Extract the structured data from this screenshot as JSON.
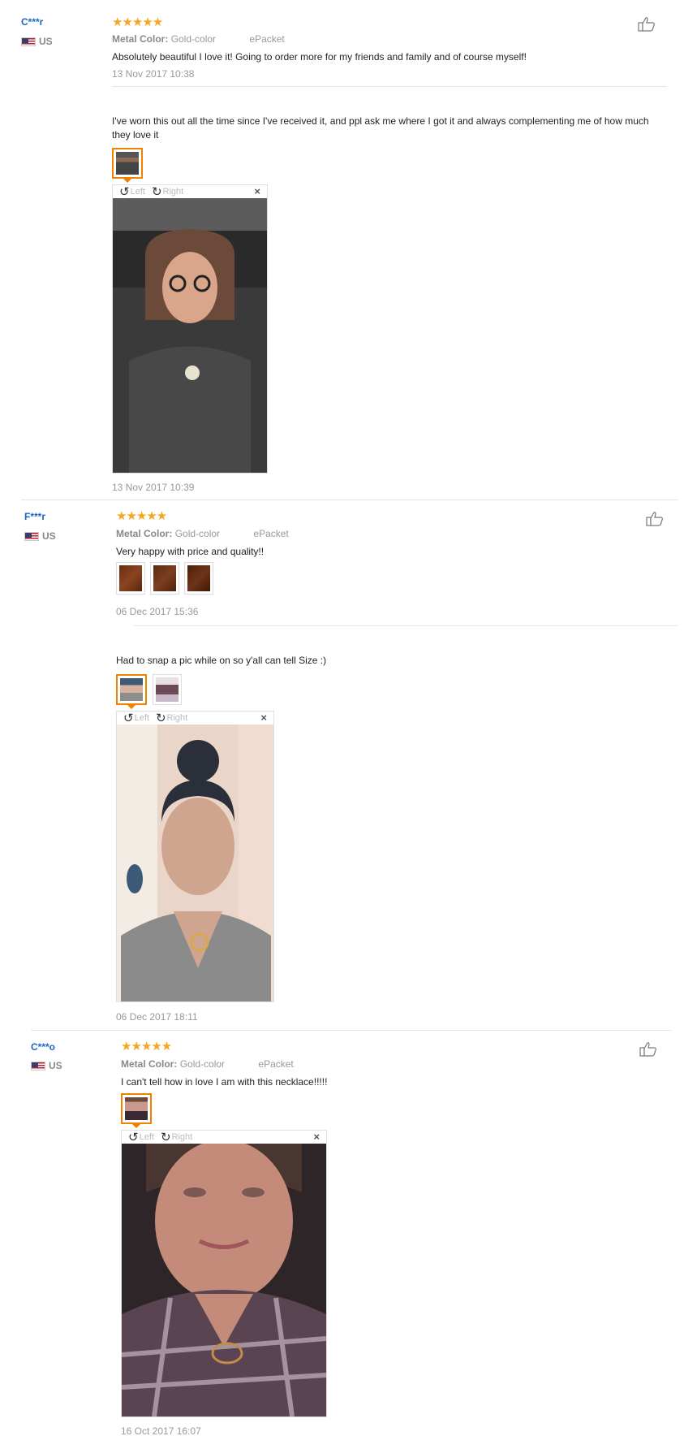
{
  "labels": {
    "metal": "Metal Color:",
    "rotate_left": "Left",
    "rotate_right": "Right",
    "close": "×"
  },
  "reviews": [
    {
      "user": "C***r",
      "country": "US",
      "stars": "★★★★★",
      "metal": "Gold-color",
      "shipping": "ePacket",
      "text": "Absolutely beautiful I love it! Going to order more for my friends and family and of course myself!",
      "date": "13 Nov 2017 10:38",
      "followup_text": "I've worn this out all the time since I've received it, and ppl ask me where I got it and always complementing me of how much they love it",
      "followup_date": "13 Nov 2017 10:39"
    },
    {
      "user": "F***r",
      "country": "US",
      "stars": "★★★★★",
      "metal": "Gold-color",
      "shipping": "ePacket",
      "text": "Very happy with price and quality!!",
      "date": "06 Dec 2017 15:36",
      "followup_text": "Had to snap a pic while on so y'all can tell Size :)",
      "followup_date": "06 Dec 2017 18:11"
    },
    {
      "user": "C***o",
      "country": "US",
      "stars": "★★★★★",
      "metal": "Gold-color",
      "shipping": "ePacket",
      "text": "I can't tell how in love I am with this necklace!!!!!",
      "date": "16 Oct 2017 16:07"
    }
  ],
  "colors": {
    "accent": "#f08200",
    "link": "#1a66c4",
    "star": "#f5a623"
  }
}
